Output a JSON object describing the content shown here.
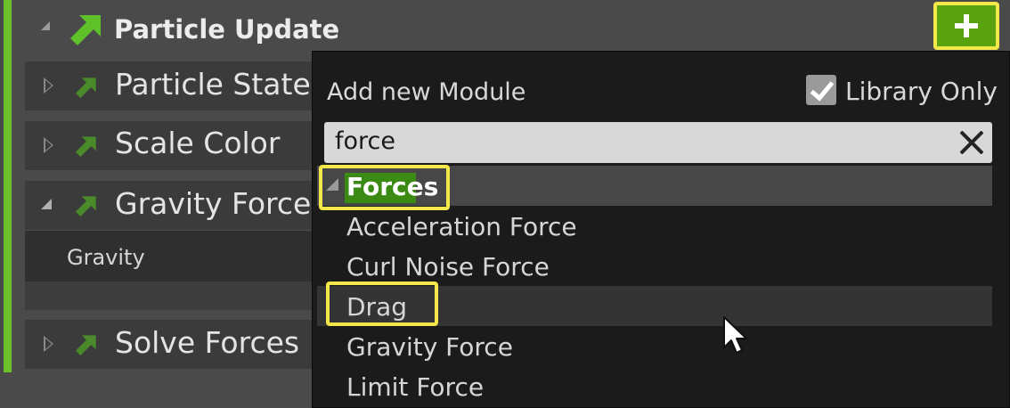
{
  "emitter": {
    "section_title": "Particle Update",
    "add_button_label": "+",
    "modules": [
      {
        "label": "Particle State",
        "expanded": false
      },
      {
        "label": "Scale Color",
        "expanded": false
      },
      {
        "label": "Gravity Force",
        "expanded": true,
        "children": [
          {
            "label": "Gravity"
          }
        ]
      },
      {
        "label": "Solve Forces",
        "expanded": false
      }
    ]
  },
  "popup": {
    "title": "Add new Module",
    "library_only_label": "Library Only",
    "library_only_checked": true,
    "search_value": "force",
    "category": "Forces",
    "items": [
      "Acceleration Force",
      "Curl Noise Force",
      "Drag",
      "Gravity Force",
      "Limit Force"
    ]
  },
  "colors": {
    "accent": "#6cc12a",
    "highlight": "#f3e84a",
    "add_button": "#5ba20f",
    "popup_bg": "#1b1b1b"
  },
  "icons": [
    "arrow-up-right-icon",
    "plus-icon",
    "checkmark-icon",
    "clear-icon",
    "mouse-cursor-icon"
  ]
}
